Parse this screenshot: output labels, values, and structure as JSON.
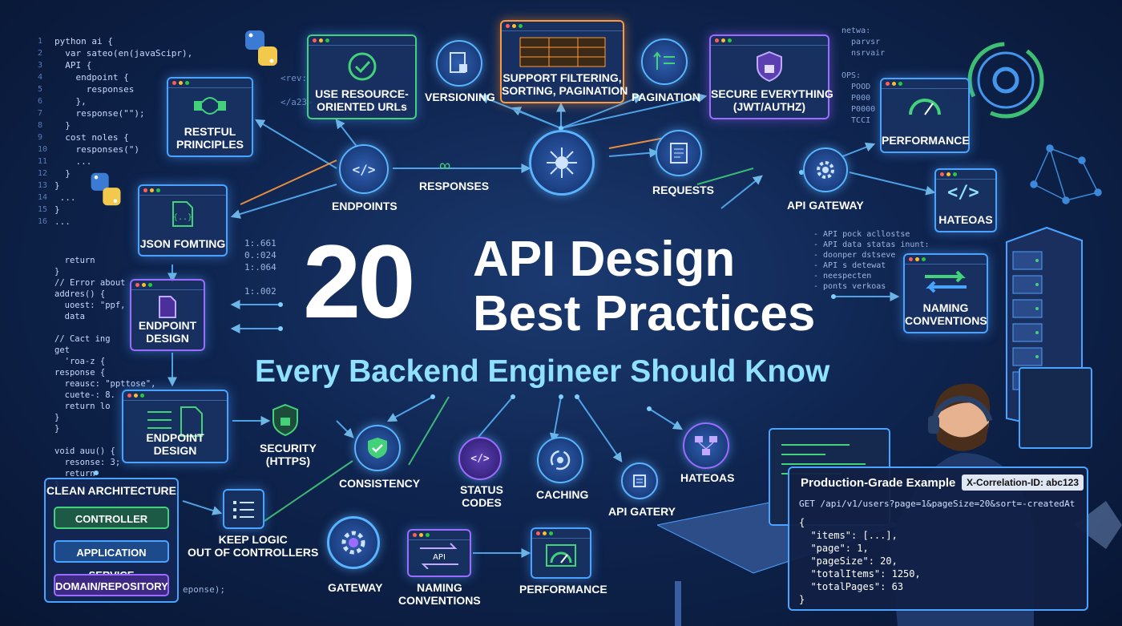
{
  "title": {
    "number": "20",
    "line1": "API Design",
    "line2": "Best Practices",
    "subtitle": "Every Backend Engineer Should Know"
  },
  "colors": {
    "accent": "#4aa3ff",
    "subtitle": "#8fe1ff",
    "orange": "#ff9a3c",
    "green": "#43d17a",
    "purple": "#9c6bff"
  },
  "nodes": {
    "restful": "RESTFUL\nPRINCIPLES",
    "resource_urls": "USE RESOURCE-\nORIENTED URLs",
    "versioning": "VERSIONING",
    "filtering": "SUPPORT FILTERING,\nSORTING, PAGINATION",
    "pagination": "PAGINATION",
    "secure": "SECURE EVERYTHING\n(JWT/AUTHZ)",
    "performance_top": "PERFORMANCE",
    "json": "JSON FOMTING",
    "endpoints": "ENDPOINTS",
    "responses": "RESPONSES",
    "requests": "REQUESTS",
    "api_gateway": "API GATEWAY",
    "hateoas_right": "HATEOAS",
    "naming_right": "NAMING\nCONVENTIONS",
    "endpoint_design_left": "ENDPOINT\nDESIGN",
    "endpoint_design_big": "ENDPOINT DESIGN",
    "security_https": "SECURITY\n(HTTPS)",
    "consistency": "CONSISTENCY",
    "status_codes": "STATUS\nCODES",
    "caching": "CACHING",
    "api_gatery": "API GATERY",
    "hateoas_mid": "HATEOAS",
    "keep_logic": "KEEP LOGIC\nOUT OF CONTROLLERS",
    "gateway": "GATEWAY",
    "naming_bottom": "NAMING\nCONVENTIONS",
    "performance_bottom": "PERFORMANCE"
  },
  "clean_architecture": {
    "title": "CLEAN ARCHITECTURE",
    "layers": [
      "CONTROLLER",
      "APPLICATION SERVICE",
      "DOMAIN/REPOSITORY"
    ]
  },
  "production_example": {
    "title": "Production-Grade Example",
    "correlation": "X-Correlation-ID: abc123",
    "request": "GET /api/v1/users?page=1&pageSize=20&sort=-createdAt",
    "json": "{\n  \"items\": [...],\n  \"page\": 1,\n  \"pageSize\": 20,\n  \"totalItems\": 1250,\n  \"totalPages\": 63\n}"
  },
  "code_left": "python ai {\n  var sateo(en(javaScipr),\n  API {\n    endpoint {\n      responses\n    },\n    response(\"\");\n  }\n  cost noles {\n    responses(\")\n    ...\n  }\n}\n ...\n}\n...",
  "code_left_lower": "  return\n}\n// Error about\naddres() {\n  uoest: \"ppf,\n  data\n\n// Cact ing\nget\n  'roa-z {\nresponse {\n  reausc: \"ppttose\",\n  cuete-: 8.\n  return lo\n}\n}\n\nvoid auu() {\n  resonse: 3;\n  return\n}",
  "code_left_nums": "1\n2\n3\n4\n5\n6\n7\n8\n9\n10\n11\n12\n13\n14\n15\n16",
  "code_mid_left": "<rev:\n\n</a23>",
  "code_numbers": "1:.661\n0.:024\n1:.064\n\n1:.002",
  "code_right_top": "netwa:\n  parvsr\n  nsrvair\n\nOPS:\n  POOD\n  P000\n  P0000\n  TCCI",
  "code_right_mid": "- API pock acllostse\n- API data statas inunt:\n- doonper dstseve\n- API s detewat\n- neespecten\n- ponts verkoas",
  "code_bottom": "eponse);"
}
